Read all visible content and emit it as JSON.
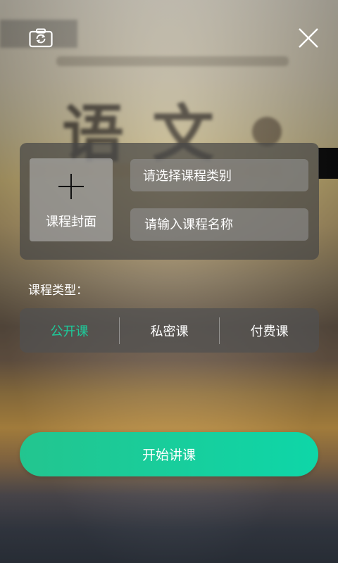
{
  "top_bar": {
    "camera_icon": "camera-switch-icon",
    "close_icon": "close-icon"
  },
  "form": {
    "cover_label": "课程封面",
    "category_placeholder": "请选择课程类别",
    "name_placeholder": "请输入课程名称"
  },
  "course_type": {
    "label": "课程类型：",
    "options": [
      "公开课",
      "私密课",
      "付费课"
    ],
    "selected": "公开课",
    "accent_color": "#1ec99a"
  },
  "start_button": {
    "label": "开始讲课",
    "color": "#18cf9c"
  }
}
